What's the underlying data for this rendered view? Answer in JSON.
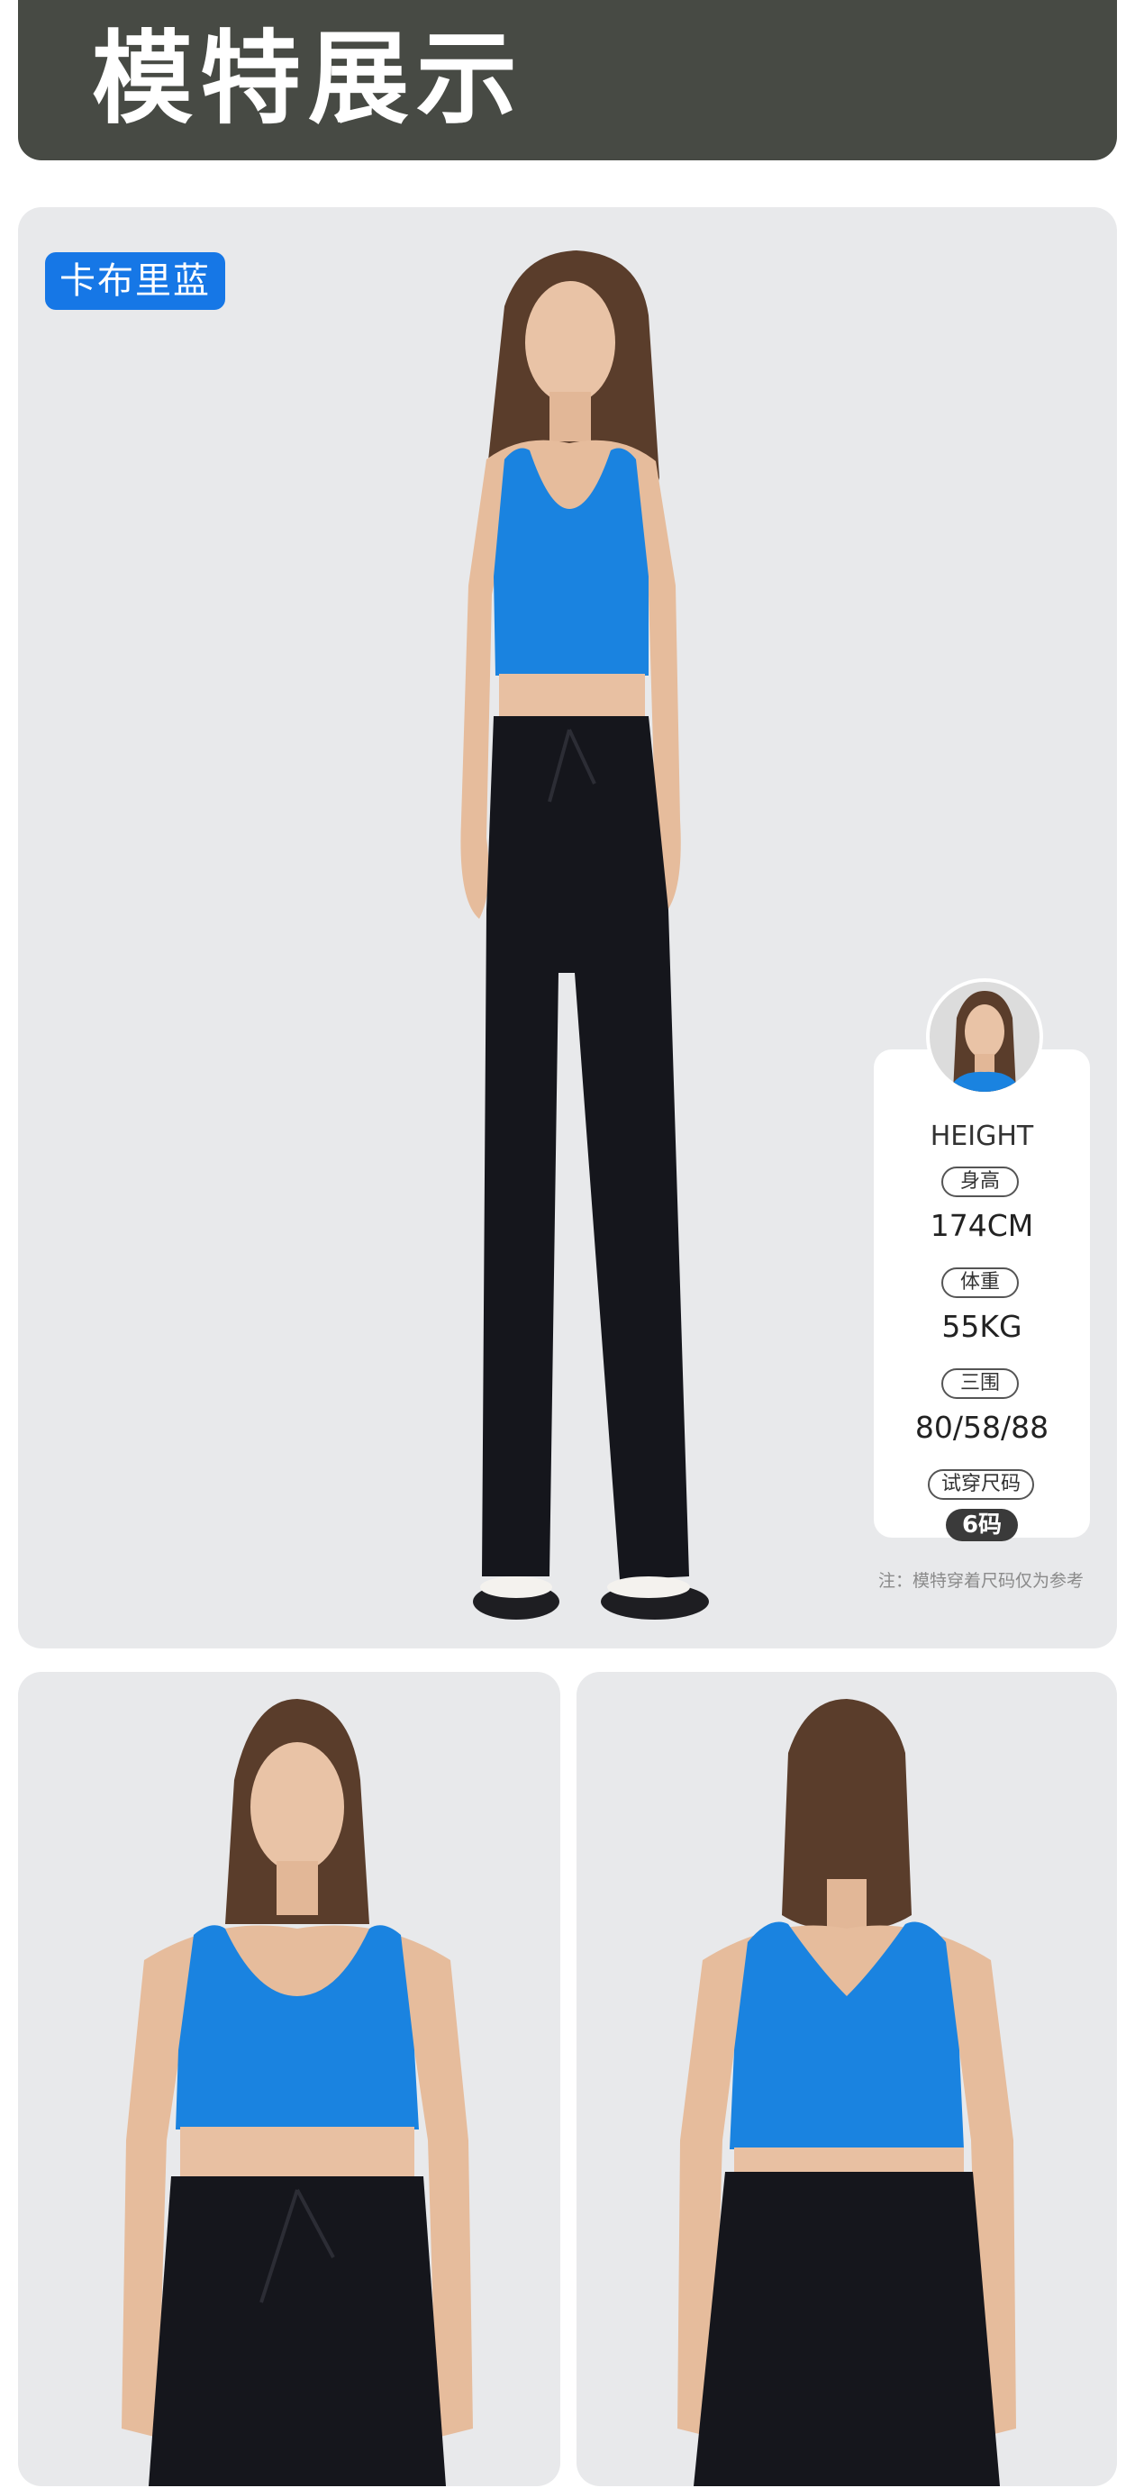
{
  "header": {
    "title": "模特展示"
  },
  "main_panel": {
    "color_label": "卡布里蓝",
    "model_card": {
      "heading": "HEIGHT",
      "stats": [
        {
          "label": "身高",
          "value": "174CM"
        },
        {
          "label": "体重",
          "value": "55KG"
        },
        {
          "label": "三围",
          "value": "80/58/88"
        },
        {
          "label": "试穿尺码",
          "value": "6码"
        }
      ]
    },
    "note": "注：模特穿着尺码仅为参考"
  },
  "colors": {
    "header_bg": "#474a44",
    "badge_blue": "#1677e6",
    "top_blue": "#1a83e0",
    "pants_black": "#15161c",
    "panel_bg": "#e8e9eb"
  }
}
